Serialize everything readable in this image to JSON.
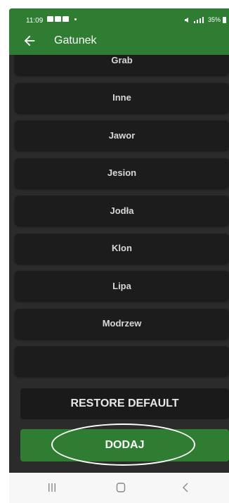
{
  "status_bar": {
    "time": "11:09",
    "right_text": "35%"
  },
  "app_bar": {
    "title": "Gatunek"
  },
  "list": {
    "items": [
      {
        "label": "Grab"
      },
      {
        "label": "Inne"
      },
      {
        "label": "Jawor"
      },
      {
        "label": "Jesion"
      },
      {
        "label": "Jodła"
      },
      {
        "label": "Klon"
      },
      {
        "label": "Lipa"
      },
      {
        "label": "Modrzew"
      },
      {
        "label": ""
      }
    ]
  },
  "buttons": {
    "restore_default": "RESTORE DEFAULT",
    "add": "DODAJ"
  },
  "colors": {
    "accent": "#2e7d32",
    "background": "#2b2b2b",
    "item_background": "#1c1c1c"
  },
  "icons": {
    "back": "arrow-left-icon",
    "recents": "recents-icon",
    "home": "home-icon",
    "nav_back": "chevron-left-icon"
  }
}
